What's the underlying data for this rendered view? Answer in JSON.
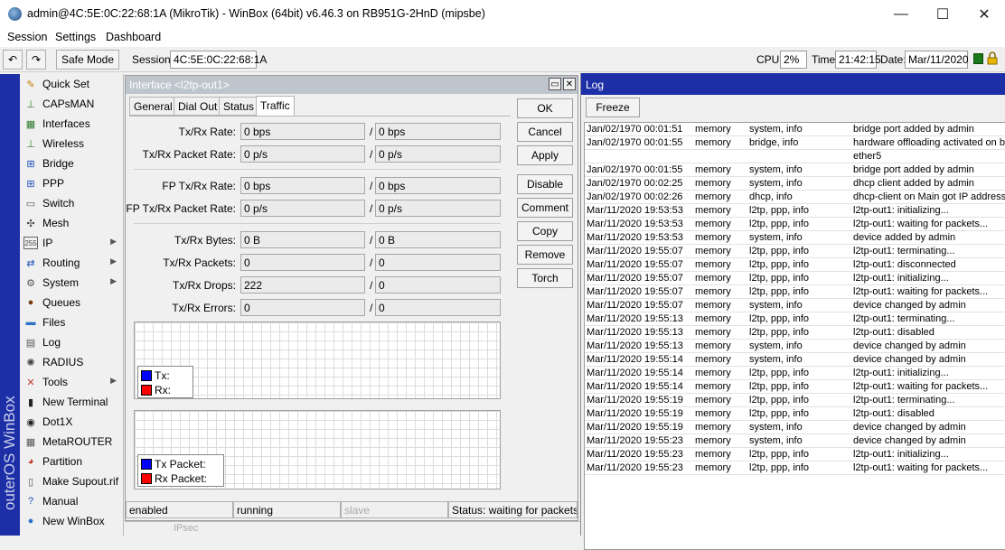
{
  "window": {
    "title": "admin@4C:5E:0C:22:68:1A (MikroTik) - WinBox (64bit) v6.46.3 on RB951G-2HnD (mipsbe)",
    "minimize": "—",
    "maximize": "☐",
    "close": "✕"
  },
  "menu": [
    "Session",
    "Settings",
    "Dashboard"
  ],
  "toolbar": {
    "undo": "↶",
    "redo": "↷",
    "safe_mode": "Safe Mode",
    "session_label": "Session:",
    "session_value": "4C:5E:0C:22:68:1A",
    "cpu_label": "CPU:",
    "cpu_value": "2%",
    "time_label": "Time:",
    "time_value": "21:42:15",
    "date_label": "Date:",
    "date_value": "Mar/11/2020"
  },
  "brand_vertical": "outerOS WinBox",
  "sidebar": {
    "items": [
      {
        "label": "Quick Set",
        "icon": "quickset-icon",
        "glyph": "✎",
        "color": "#c47a00",
        "arrow": false
      },
      {
        "label": "CAPsMAN",
        "icon": "capsman-icon",
        "glyph": "⊥",
        "color": "#2a7a2a",
        "arrow": false
      },
      {
        "label": "Interfaces",
        "icon": "interfaces-icon",
        "glyph": "▦",
        "color": "#2a7a2a",
        "arrow": false
      },
      {
        "label": "Wireless",
        "icon": "wireless-icon",
        "glyph": "⊥",
        "color": "#2a7a2a",
        "arrow": false
      },
      {
        "label": "Bridge",
        "icon": "bridge-icon",
        "glyph": "⊞",
        "color": "#1d4fb5",
        "arrow": false
      },
      {
        "label": "PPP",
        "icon": "ppp-icon",
        "glyph": "⊞",
        "color": "#1d4fb5",
        "arrow": false
      },
      {
        "label": "Switch",
        "icon": "switch-icon",
        "glyph": "▭",
        "color": "#555555",
        "arrow": false
      },
      {
        "label": "Mesh",
        "icon": "mesh-icon",
        "glyph": "✣",
        "color": "#444444",
        "arrow": false
      },
      {
        "label": "IP",
        "icon": "ip-icon",
        "glyph": "255",
        "color": "#444444",
        "arrow": true
      },
      {
        "label": "Routing",
        "icon": "routing-icon",
        "glyph": "⇄",
        "color": "#1d4fb5",
        "arrow": true
      },
      {
        "label": "System",
        "icon": "system-icon",
        "glyph": "⚙",
        "color": "#555555",
        "arrow": true
      },
      {
        "label": "Queues",
        "icon": "queues-icon",
        "glyph": "●",
        "color": "#7a3d10",
        "arrow": false
      },
      {
        "label": "Files",
        "icon": "files-icon",
        "glyph": "▬",
        "color": "#2b6fc9",
        "arrow": false
      },
      {
        "label": "Log",
        "icon": "log-icon",
        "glyph": "▤",
        "color": "#555555",
        "arrow": false
      },
      {
        "label": "RADIUS",
        "icon": "radius-icon",
        "glyph": "✺",
        "color": "#444444",
        "arrow": false
      },
      {
        "label": "Tools",
        "icon": "tools-icon",
        "glyph": "✕",
        "color": "#c0392b",
        "arrow": true
      },
      {
        "label": "New Terminal",
        "icon": "terminal-icon",
        "glyph": "▮",
        "color": "#222222",
        "arrow": false
      },
      {
        "label": "Dot1X",
        "icon": "dot1x-icon",
        "glyph": "◉",
        "color": "#222222",
        "arrow": false
      },
      {
        "label": "MetaROUTER",
        "icon": "metarouter-icon",
        "glyph": "▦",
        "color": "#555555",
        "arrow": false
      },
      {
        "label": "Partition",
        "icon": "partition-icon",
        "glyph": "◕",
        "color": "#c0392b",
        "arrow": false
      },
      {
        "label": "Make Supout.rif",
        "icon": "supout-icon",
        "glyph": "▯",
        "color": "#555555",
        "arrow": false
      },
      {
        "label": "Manual",
        "icon": "manual-icon",
        "glyph": "?",
        "color": "#1d4fb5",
        "arrow": false
      },
      {
        "label": "New WinBox",
        "icon": "winbox-icon",
        "glyph": "●",
        "color": "#2b6fc9",
        "arrow": false
      }
    ]
  },
  "interface_window": {
    "title": "Interface <l2tp-out1>",
    "restore": "▭",
    "close": "✕",
    "tabs": [
      "General",
      "Dial Out",
      "Status",
      "Traffic"
    ],
    "active_tab": "Traffic",
    "fields": [
      {
        "label": "Tx/Rx Rate:",
        "tx": "0 bps",
        "rx": "0 bps"
      },
      {
        "label": "Tx/Rx Packet Rate:",
        "tx": "0 p/s",
        "rx": "0 p/s"
      },
      {
        "label": "FP Tx/Rx Rate:",
        "tx": "0 bps",
        "rx": "0 bps"
      },
      {
        "label": "FP Tx/Rx Packet Rate:",
        "tx": "0 p/s",
        "rx": "0 p/s"
      },
      {
        "label": "Tx/Rx Bytes:",
        "tx": "0 B",
        "rx": "0 B"
      },
      {
        "label": "Tx/Rx Packets:",
        "tx": "0",
        "rx": "0"
      },
      {
        "label": "Tx/Rx Drops:",
        "tx": "222",
        "rx": "0"
      },
      {
        "label": "Tx/Rx Errors:",
        "tx": "0",
        "rx": "0"
      }
    ],
    "slash": "/",
    "buttons": [
      "OK",
      "Cancel",
      "Apply",
      "Disable",
      "Comment",
      "Copy",
      "Remove",
      "Torch"
    ],
    "graph1_legend": [
      {
        "label": "Tx:",
        "color": "#0000ff"
      },
      {
        "label": "Rx:",
        "color": "#ff0000"
      }
    ],
    "graph2_legend": [
      {
        "label": "Tx Packet:",
        "color": "#0000ff"
      },
      {
        "label": "Rx Packet:",
        "color": "#ff0000"
      }
    ],
    "status": [
      "enabled",
      "running",
      "slave",
      "Status: waiting for packets..."
    ]
  },
  "log_window": {
    "title": "Log",
    "freeze": "Freeze",
    "rows": [
      {
        "time": "Jan/02/1970 00:01:51",
        "buffer": "memory",
        "topics": "system, info",
        "message": "bridge port added by admin"
      },
      {
        "time": "Jan/02/1970 00:01:55",
        "buffer": "memory",
        "topics": "bridge, info",
        "message": "hardware offloading activated on bri"
      },
      {
        "time": "",
        "buffer": "",
        "topics": "",
        "message": "ether5"
      },
      {
        "time": "Jan/02/1970 00:01:55",
        "buffer": "memory",
        "topics": "system, info",
        "message": "bridge port added by admin"
      },
      {
        "time": "Jan/02/1970 00:02:25",
        "buffer": "memory",
        "topics": "system, info",
        "message": "dhcp client added by admin"
      },
      {
        "time": "Jan/02/1970 00:02:26",
        "buffer": "memory",
        "topics": "dhcp, info",
        "message": "dhcp-client on Main got IP address"
      },
      {
        "time": "Mar/11/2020 19:53:53",
        "buffer": "memory",
        "topics": "l2tp, ppp, info",
        "message": "l2tp-out1: initializing..."
      },
      {
        "time": "Mar/11/2020 19:53:53",
        "buffer": "memory",
        "topics": "l2tp, ppp, info",
        "message": "l2tp-out1: waiting for packets..."
      },
      {
        "time": "Mar/11/2020 19:53:53",
        "buffer": "memory",
        "topics": "system, info",
        "message": "device added by admin"
      },
      {
        "time": "Mar/11/2020 19:55:07",
        "buffer": "memory",
        "topics": "l2tp, ppp, info",
        "message": "l2tp-out1: terminating..."
      },
      {
        "time": "Mar/11/2020 19:55:07",
        "buffer": "memory",
        "topics": "l2tp, ppp, info",
        "message": "l2tp-out1: disconnected"
      },
      {
        "time": "Mar/11/2020 19:55:07",
        "buffer": "memory",
        "topics": "l2tp, ppp, info",
        "message": "l2tp-out1: initializing..."
      },
      {
        "time": "Mar/11/2020 19:55:07",
        "buffer": "memory",
        "topics": "l2tp, ppp, info",
        "message": "l2tp-out1: waiting for packets..."
      },
      {
        "time": "Mar/11/2020 19:55:07",
        "buffer": "memory",
        "topics": "system, info",
        "message": "device changed by admin"
      },
      {
        "time": "Mar/11/2020 19:55:13",
        "buffer": "memory",
        "topics": "l2tp, ppp, info",
        "message": "l2tp-out1: terminating..."
      },
      {
        "time": "Mar/11/2020 19:55:13",
        "buffer": "memory",
        "topics": "l2tp, ppp, info",
        "message": "l2tp-out1: disabled"
      },
      {
        "time": "Mar/11/2020 19:55:13",
        "buffer": "memory",
        "topics": "system, info",
        "message": "device changed by admin"
      },
      {
        "time": "Mar/11/2020 19:55:14",
        "buffer": "memory",
        "topics": "system, info",
        "message": "device changed by admin"
      },
      {
        "time": "Mar/11/2020 19:55:14",
        "buffer": "memory",
        "topics": "l2tp, ppp, info",
        "message": "l2tp-out1: initializing..."
      },
      {
        "time": "Mar/11/2020 19:55:14",
        "buffer": "memory",
        "topics": "l2tp, ppp, info",
        "message": "l2tp-out1: waiting for packets..."
      },
      {
        "time": "Mar/11/2020 19:55:19",
        "buffer": "memory",
        "topics": "l2tp, ppp, info",
        "message": "l2tp-out1: terminating..."
      },
      {
        "time": "Mar/11/2020 19:55:19",
        "buffer": "memory",
        "topics": "l2tp, ppp, info",
        "message": "l2tp-out1: disabled"
      },
      {
        "time": "Mar/11/2020 19:55:19",
        "buffer": "memory",
        "topics": "system, info",
        "message": "device changed by admin"
      },
      {
        "time": "Mar/11/2020 19:55:23",
        "buffer": "memory",
        "topics": "system, info",
        "message": "device changed by admin"
      },
      {
        "time": "Mar/11/2020 19:55:23",
        "buffer": "memory",
        "topics": "l2tp, ppp, info",
        "message": "l2tp-out1: initializing..."
      },
      {
        "time": "Mar/11/2020 19:55:23",
        "buffer": "memory",
        "topics": "l2tp, ppp, info",
        "message": "l2tp-out1: waiting for packets..."
      }
    ]
  },
  "bottom_strip": {
    "label": "IPsec"
  },
  "colors": {
    "brand_blue": "#1d2fa6",
    "safe_green": "#1a7a1a",
    "lock_yellow": "#e8b800"
  }
}
